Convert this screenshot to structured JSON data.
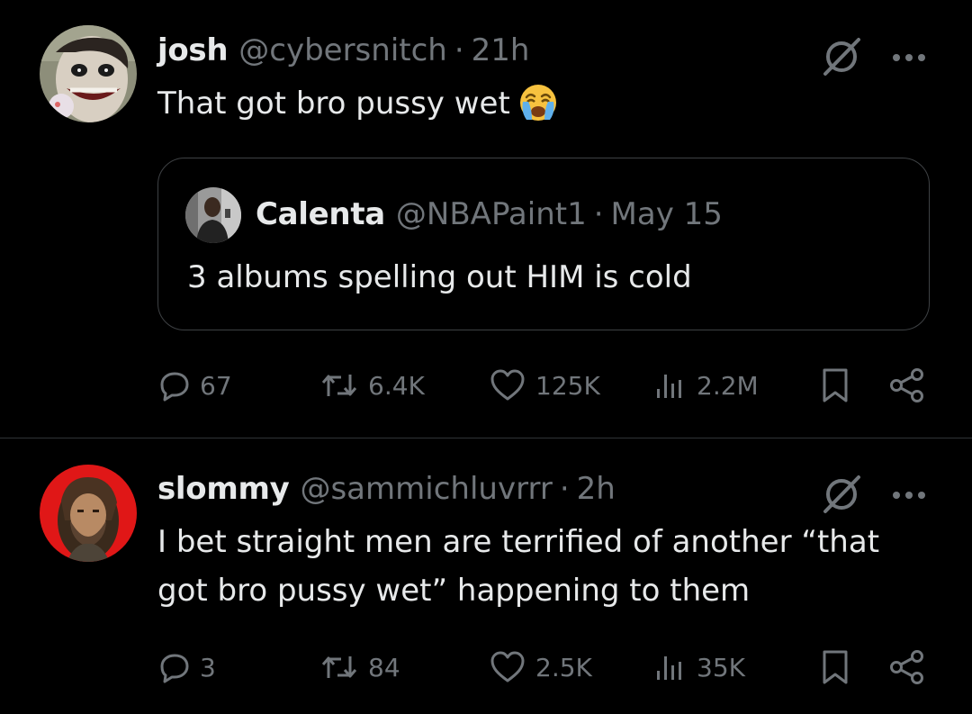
{
  "posts": [
    {
      "author": {
        "name": "josh",
        "handle": "@cybersnitch",
        "time": "21h"
      },
      "text": "That got bro pussy wet",
      "emoji": "loudly-crying-face",
      "quote": {
        "author": {
          "name": "Calenta",
          "handle": "@NBAPaint1",
          "time": "May 15"
        },
        "text": "3 albums spelling out HIM is cold"
      },
      "stats": {
        "replies": "67",
        "reposts": "6.4K",
        "likes": "125K",
        "views": "2.2M"
      }
    },
    {
      "author": {
        "name": "slommy",
        "handle": "@sammichluvrrr",
        "time": "2h"
      },
      "text": "I bet straight men are terrified of another “that got bro pussy wet” happening to them",
      "stats": {
        "replies": "3",
        "reposts": "84",
        "likes": "2.5K",
        "views": "35K"
      }
    }
  ],
  "separator": "·",
  "colors": {
    "background": "#000000",
    "text_primary": "#e7e9ea",
    "text_secondary": "#71767b",
    "border": "#2f3336",
    "emoji_yellow": "#f7c23f",
    "emoji_blue": "#5fb0ec"
  },
  "icons": [
    "grok-icon",
    "more-icon",
    "reply-icon",
    "repost-icon",
    "like-icon",
    "views-icon",
    "bookmark-icon",
    "share-icon"
  ]
}
